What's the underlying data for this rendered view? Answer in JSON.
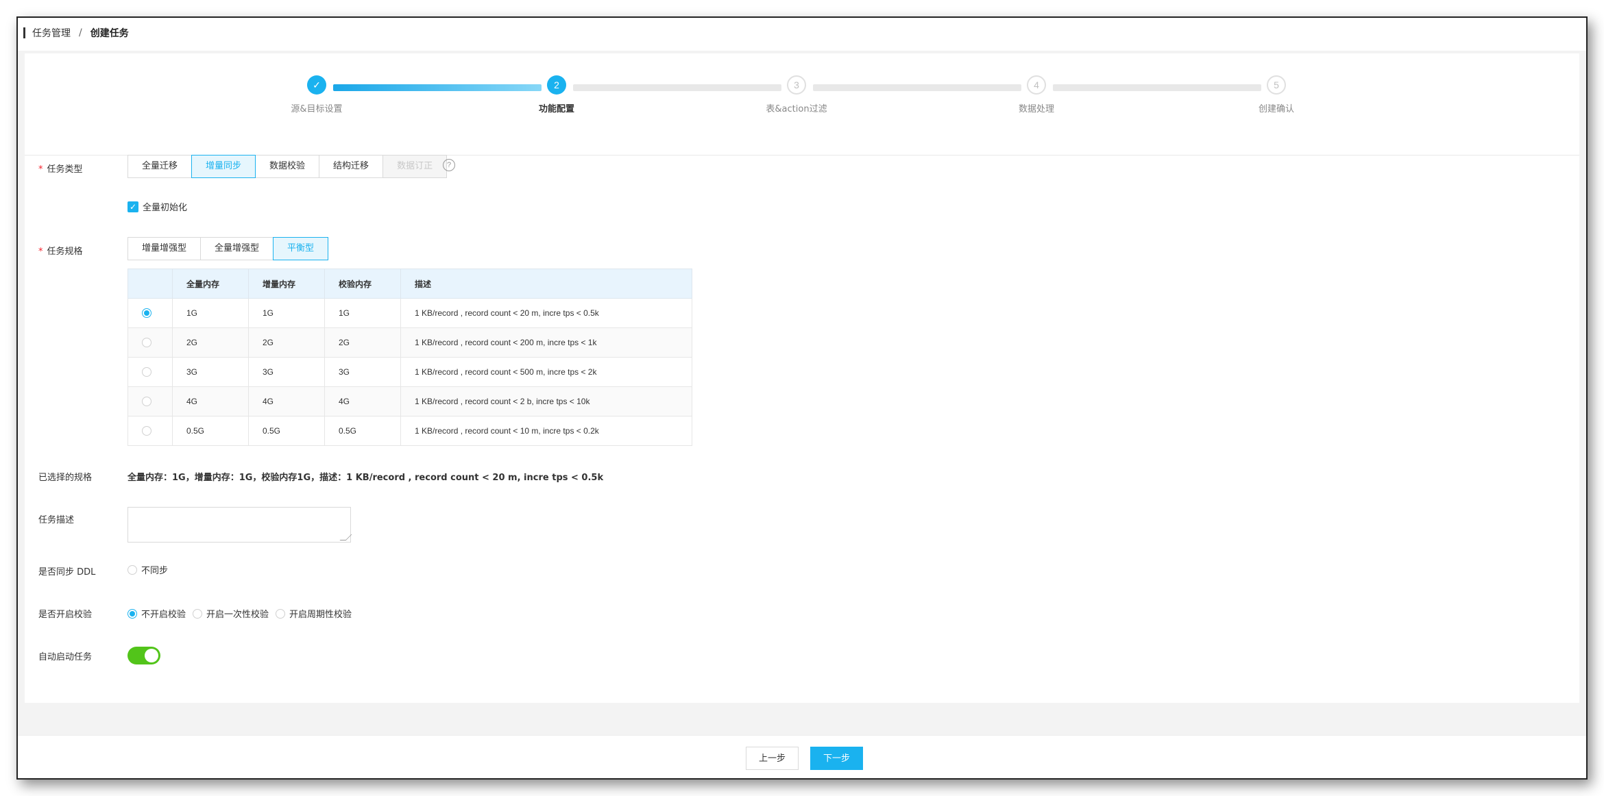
{
  "breadcrumb": {
    "parent": "任务管理",
    "separator": "/",
    "current": "创建任务"
  },
  "steps": [
    {
      "label": "源&目标设置",
      "number": "✓",
      "state": "done"
    },
    {
      "label": "功能配置",
      "number": "2",
      "state": "active"
    },
    {
      "label": "表&action过滤",
      "number": "3",
      "state": "pending"
    },
    {
      "label": "数据处理",
      "number": "4",
      "state": "pending"
    },
    {
      "label": "创建确认",
      "number": "5",
      "state": "pending"
    }
  ],
  "task_type": {
    "label": "任务类型",
    "required_mark": "*",
    "options": [
      "全量迁移",
      "增量同步",
      "数据校验",
      "结构迁移",
      "数据订正"
    ],
    "selected": "增量同步",
    "disabled": "数据订正",
    "help_icon": "?"
  },
  "full_init": {
    "label": "全量初始化",
    "checked": true,
    "check_glyph": "✓"
  },
  "task_spec": {
    "label": "任务规格",
    "required_mark": "*",
    "options": [
      "增量增强型",
      "全量增强型",
      "平衡型"
    ],
    "selected": "平衡型"
  },
  "spec_table": {
    "headers": [
      "",
      "全量内存",
      "增量内存",
      "校验内存",
      "描述"
    ],
    "rows": [
      {
        "selected": true,
        "full": "1G",
        "incr": "1G",
        "check": "1G",
        "desc": "1 KB/record , record count < 20 m, incre tps < 0.5k"
      },
      {
        "selected": false,
        "full": "2G",
        "incr": "2G",
        "check": "2G",
        "desc": "1 KB/record , record count < 200 m, incre tps < 1k"
      },
      {
        "selected": false,
        "full": "3G",
        "incr": "3G",
        "check": "3G",
        "desc": "1 KB/record , record count < 500 m, incre tps < 2k"
      },
      {
        "selected": false,
        "full": "4G",
        "incr": "4G",
        "check": "4G",
        "desc": "1 KB/record , record count < 2 b, incre tps < 10k"
      },
      {
        "selected": false,
        "full": "0.5G",
        "incr": "0.5G",
        "check": "0.5G",
        "desc": "1 KB/record , record count < 10 m, incre tps < 0.2k"
      }
    ]
  },
  "selected_spec": {
    "label": "已选择的规格",
    "value": "全量内存：1G，增量内存：1G，校验内存1G，描述：1 KB/record , record count < 20 m, incre tps < 0.5k"
  },
  "task_desc": {
    "label": "任务描述",
    "value": ""
  },
  "sync_ddl": {
    "label": "是否同步 DDL",
    "option": "不同步",
    "checked": false
  },
  "verify": {
    "label": "是否开启校验",
    "options": [
      "不开启校验",
      "开启一次性校验",
      "开启周期性校验"
    ],
    "selected": "不开启校验"
  },
  "auto_start": {
    "label": "自动启动任务",
    "on": true
  },
  "footer": {
    "prev": "上一步",
    "next": "下一步"
  },
  "colors": {
    "accent": "#1ab2ef",
    "toggle_on": "#52c41a",
    "required": "#f5222d"
  }
}
